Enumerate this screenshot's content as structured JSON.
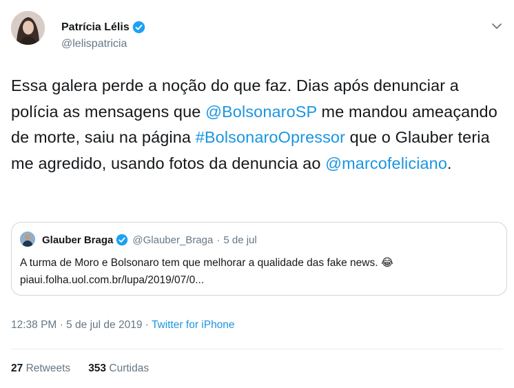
{
  "author": {
    "name": "Patrícia Lélis",
    "handle": "@lelispatricia"
  },
  "tweet": {
    "t1": "Essa galera perde a noção do que faz. Dias após denunciar a polícia as mensagens que ",
    "mention1": "@BolsonaroSP",
    "t2": " me mandou ameaçando de morte, saiu na página ",
    "hashtag": "#BolsonaroOpressor",
    "t3": " que o Glauber teria me agredido, usando fotos da denuncia ao ",
    "mention2": "@marcofeliciano",
    "t4": "."
  },
  "quote": {
    "name": "Glauber Braga",
    "handle": "@Glauber_Braga",
    "separator": "·",
    "date": "5 de jul",
    "line1": "A turma de Moro e Bolsonaro tem que melhorar a qualidade das fake news. 😂",
    "line2": "piaui.folha.uol.com.br/lupa/2019/07/0..."
  },
  "meta": {
    "time_date": "12:38 PM · 5 de jul de 2019 · ",
    "source": "Twitter for iPhone"
  },
  "stats": {
    "retweets_count": "27",
    "retweets_label": "Retweets",
    "likes_count": "353",
    "likes_label": "Curtidas"
  },
  "colors": {
    "link": "#1b95e0",
    "verified": "#1da1f2",
    "secondary_text": "#657786"
  },
  "icons": [
    "verified-badge-icon",
    "chevron-down-icon"
  ]
}
